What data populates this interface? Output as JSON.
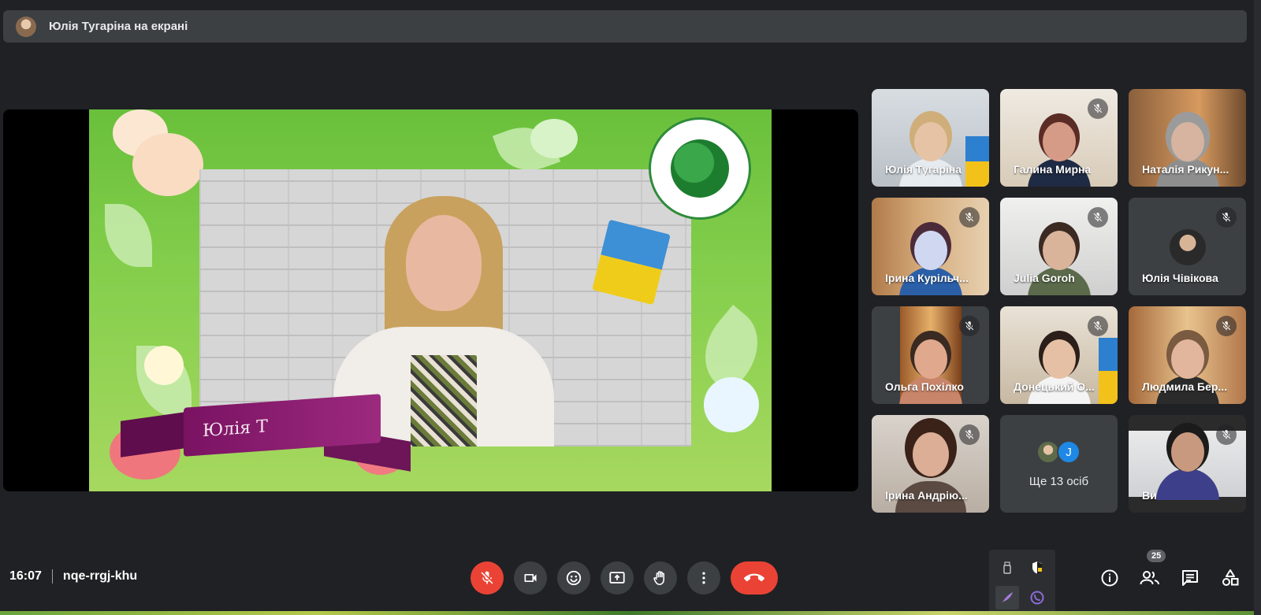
{
  "header": {
    "presenting_title": "Юлія Тугаріна на екрані"
  },
  "stage": {
    "ribbon_text": "Юлія Т"
  },
  "tiles": [
    {
      "name": "Юлія Тугаріна",
      "muted": false
    },
    {
      "name": "Галина Мирна",
      "muted": true
    },
    {
      "name": "Наталія Рикун...",
      "muted": false
    },
    {
      "name": "Ірина Курільч...",
      "muted": true
    },
    {
      "name": "Julia Goroh",
      "muted": true
    },
    {
      "name": "Юлія Чівікова",
      "muted": true
    },
    {
      "name": "Ольга Похілко",
      "muted": true
    },
    {
      "name": "Донецький О...",
      "muted": true
    },
    {
      "name": "Людмила Бер...",
      "muted": true
    },
    {
      "name": "Ірина Андрію...",
      "muted": true
    },
    {
      "name": "Ви",
      "muted": true
    }
  ],
  "more_tile": {
    "label": "Ще 13 осіб",
    "initial": "J"
  },
  "meeting": {
    "time": "16:07",
    "code": "nqe-rrgj-khu"
  },
  "controls": {
    "mic": "mic-off-icon",
    "camera": "videocam-icon",
    "reactions": "emoji-icon",
    "present": "present-screen-icon",
    "hand": "raise-hand-icon",
    "more": "more-vert-icon",
    "end": "call-end-icon"
  },
  "right_panel": {
    "participants_count": "25"
  },
  "colors": {
    "background": "#202124",
    "surface": "#3c4043",
    "danger": "#ea4335",
    "accent": "#1e88e5"
  }
}
